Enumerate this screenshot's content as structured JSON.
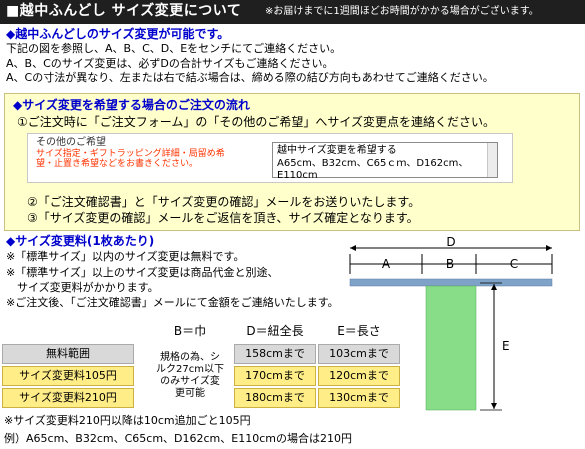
{
  "header": {
    "title": "■越中ふんどし サイズ変更について",
    "note": "※お届けまでに1週間ほどお時間がかかる場合がございます。"
  },
  "section1": {
    "heading": "◆越中ふんどしのサイズ変更が可能です。",
    "lines": [
      "下記の図を参照し、A、B、C、D、Eをセンチにてご連絡ください。",
      "A、B、Cのサイズ変更は、必ずDの合計サイズもご連絡ください。",
      "A、Cの寸法が異なり、左または右で結ぶ場合は、締める際の結び方向もあわせてご連絡ください。"
    ]
  },
  "flow": {
    "heading": "◆サイズ変更を希望する場合のご注文の流れ",
    "step1": "①ご注文時に「ご注文フォーム」の「その他のご希望」へサイズ変更点を連絡ください。",
    "form_label": "その他のご希望",
    "form_note": "サイズ指定・ギフトラッピング詳細・局留め希望・止置き希望などをお書きください。",
    "textarea_line1": "越中サイズ変更を希望する",
    "textarea_line2": "A65cm、B32cm、C65ｃｍ、D162cm、E110cm",
    "step2": "②「ご注文確認書」と「サイズ変更の確認」メールをお送りいたします。",
    "step3": "③「サイズ変更の確認」メールをご返信を頂き、サイズ確定となります。"
  },
  "fee": {
    "heading": "◆サイズ変更料(1枚あたり)",
    "lines": [
      "※「標準サイズ」以内のサイズ変更は無料です。",
      "※「標準サイズ」以上のサイズ変更は商品代金と別途、",
      "　サイズ変更料がかかります。",
      "※ご注文後、「ご注文確認書」メールにて金額をご連絡いたします。"
    ]
  },
  "table": {
    "col_b": "B＝巾",
    "col_d": "D＝紐全長",
    "col_e": "E＝長さ",
    "b_note": "規格の為、シルク27cm以下のみサイズ変更可能",
    "rows": [
      {
        "label": "無料範囲",
        "d": "158cmまで",
        "e": "103cmまで"
      },
      {
        "label": "サイズ変更料105円",
        "d": "170cmまで",
        "e": "120cmまで"
      },
      {
        "label": "サイズ変更料210円",
        "d": "180cmまで",
        "e": "130cmまで"
      }
    ]
  },
  "notes": {
    "line1": "※サイズ変更料210円以降は10cm追加ごと105円",
    "line2": "例）A65cm、B32cm、C65cm、D162cm、E110cmの場合は210円"
  },
  "diagram": {
    "label_a": "A",
    "label_b": "B",
    "label_c": "C",
    "label_d": "D",
    "label_e": "E",
    "color_fabric": "#88dd88",
    "color_string": "#7fa2c8"
  }
}
